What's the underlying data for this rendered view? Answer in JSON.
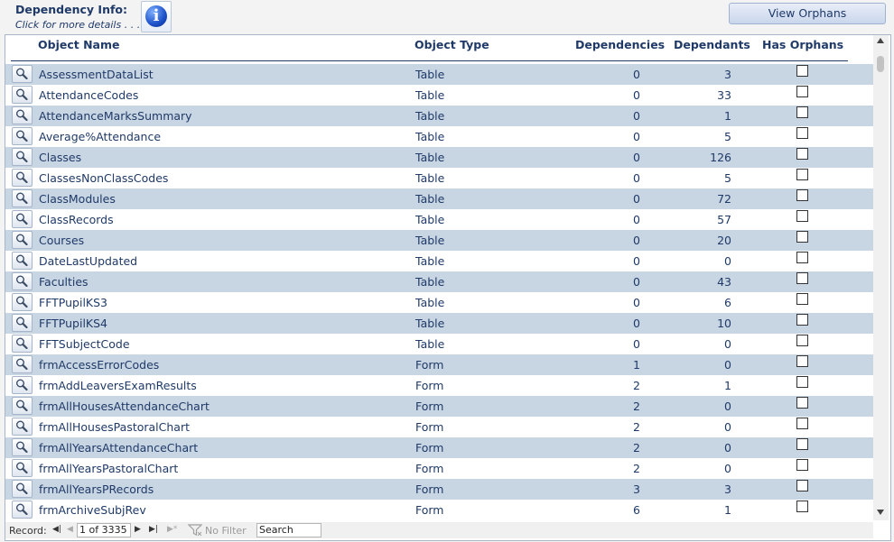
{
  "header": {
    "title": "Dependency Info:",
    "subtitle": "Click for more details . . .",
    "info_icon_glyph": "i",
    "view_orphans_label": "View Orphans"
  },
  "columns": {
    "object_name": "Object Name",
    "object_type": "Object Type",
    "dependencies": "Dependencies",
    "dependants": "Dependants",
    "has_orphans": "Has Orphans"
  },
  "rows": [
    {
      "name": "AssessmentDataList",
      "type": "Table",
      "dependencies": "0",
      "dependants": "3"
    },
    {
      "name": "AttendanceCodes",
      "type": "Table",
      "dependencies": "0",
      "dependants": "33"
    },
    {
      "name": "AttendanceMarksSummary",
      "type": "Table",
      "dependencies": "0",
      "dependants": "1"
    },
    {
      "name": "Average%Attendance",
      "type": "Table",
      "dependencies": "0",
      "dependants": "5"
    },
    {
      "name": "Classes",
      "type": "Table",
      "dependencies": "0",
      "dependants": "126"
    },
    {
      "name": "ClassesNonClassCodes",
      "type": "Table",
      "dependencies": "0",
      "dependants": "5"
    },
    {
      "name": "ClassModules",
      "type": "Table",
      "dependencies": "0",
      "dependants": "72"
    },
    {
      "name": "ClassRecords",
      "type": "Table",
      "dependencies": "0",
      "dependants": "57"
    },
    {
      "name": "Courses",
      "type": "Table",
      "dependencies": "0",
      "dependants": "20"
    },
    {
      "name": "DateLastUpdated",
      "type": "Table",
      "dependencies": "0",
      "dependants": "0"
    },
    {
      "name": "Faculties",
      "type": "Table",
      "dependencies": "0",
      "dependants": "43"
    },
    {
      "name": "FFTPupilKS3",
      "type": "Table",
      "dependencies": "0",
      "dependants": "6"
    },
    {
      "name": "FFTPupilKS4",
      "type": "Table",
      "dependencies": "0",
      "dependants": "10"
    },
    {
      "name": "FFTSubjectCode",
      "type": "Table",
      "dependencies": "0",
      "dependants": "0"
    },
    {
      "name": "frmAccessErrorCodes",
      "type": "Form",
      "dependencies": "1",
      "dependants": "0"
    },
    {
      "name": "frmAddLeaversExamResults",
      "type": "Form",
      "dependencies": "2",
      "dependants": "1"
    },
    {
      "name": "frmAllHousesAttendanceChart",
      "type": "Form",
      "dependencies": "2",
      "dependants": "0"
    },
    {
      "name": "frmAllHousesPastoralChart",
      "type": "Form",
      "dependencies": "2",
      "dependants": "0"
    },
    {
      "name": "frmAllYearsAttendanceChart",
      "type": "Form",
      "dependencies": "2",
      "dependants": "0"
    },
    {
      "name": "frmAllYearsPastoralChart",
      "type": "Form",
      "dependencies": "2",
      "dependants": "0"
    },
    {
      "name": "frmAllYearsPRecords",
      "type": "Form",
      "dependencies": "3",
      "dependants": "3"
    },
    {
      "name": "frmArchiveSubjRev",
      "type": "Form",
      "dependencies": "6",
      "dependants": "1"
    }
  ],
  "navigation": {
    "record_label": "Record:",
    "record_position": "1 of 3335",
    "no_filter_label": "No Filter",
    "search_placeholder": "Search"
  }
}
